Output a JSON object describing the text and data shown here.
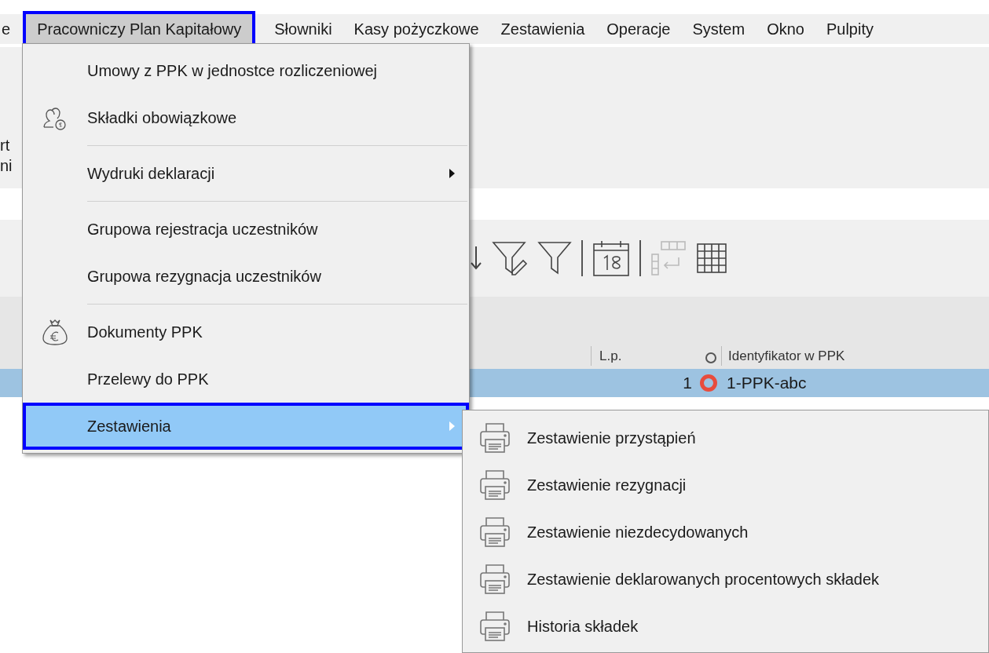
{
  "menubar": {
    "items": [
      {
        "label": "e",
        "selected": false
      },
      {
        "label": "Pracowniczy Plan Kapitałowy",
        "selected": true
      },
      {
        "label": "Słowniki",
        "selected": false
      },
      {
        "label": "Kasy pożyczkowe",
        "selected": false
      },
      {
        "label": "Zestawienia",
        "selected": false
      },
      {
        "label": "Operacje",
        "selected": false
      },
      {
        "label": "System",
        "selected": false
      },
      {
        "label": "Okno",
        "selected": false
      },
      {
        "label": "Pulpity",
        "selected": false
      }
    ]
  },
  "background": {
    "side_texts": [
      "rt",
      "ni"
    ],
    "table": {
      "columns": [
        "L.p.",
        "Identyfikator w PPK"
      ],
      "rows": [
        {
          "lp": "1",
          "identifier": "1-PPK-abc",
          "selected": true,
          "color": "#e84c3d"
        }
      ]
    }
  },
  "menu": {
    "items": [
      {
        "kind": "item",
        "label": "Umowy z PPK w jednostce rozliczeniowej",
        "submenu": false,
        "selected": false
      },
      {
        "kind": "people",
        "label": "Składki obowiązkowe",
        "submenu": false,
        "selected": false
      },
      {
        "kind": "separator"
      },
      {
        "kind": "item",
        "label": "Wydruki deklaracji",
        "submenu": true,
        "selected": false
      },
      {
        "kind": "separator"
      },
      {
        "kind": "item",
        "label": "Grupowa rejestracja uczestników",
        "submenu": false,
        "selected": false
      },
      {
        "kind": "item",
        "label": "Grupowa rezygnacja uczestników",
        "submenu": false,
        "selected": false
      },
      {
        "kind": "separator"
      },
      {
        "kind": "moneybag",
        "label": "Dokumenty PPK",
        "submenu": false,
        "selected": false
      },
      {
        "kind": "item",
        "label": "Przelewy do PPK",
        "submenu": false,
        "selected": false
      },
      {
        "kind": "item",
        "label": "Zestawienia",
        "submenu": true,
        "selected": true
      }
    ]
  },
  "submenu": {
    "items": [
      {
        "label": "Zestawienie przystąpień"
      },
      {
        "label": "Zestawienie rezygnacji"
      },
      {
        "label": "Zestawienie niezdecydowanych"
      },
      {
        "label": "Zestawienie deklarowanych procentowych składek"
      },
      {
        "label": "Historia składek"
      }
    ]
  }
}
